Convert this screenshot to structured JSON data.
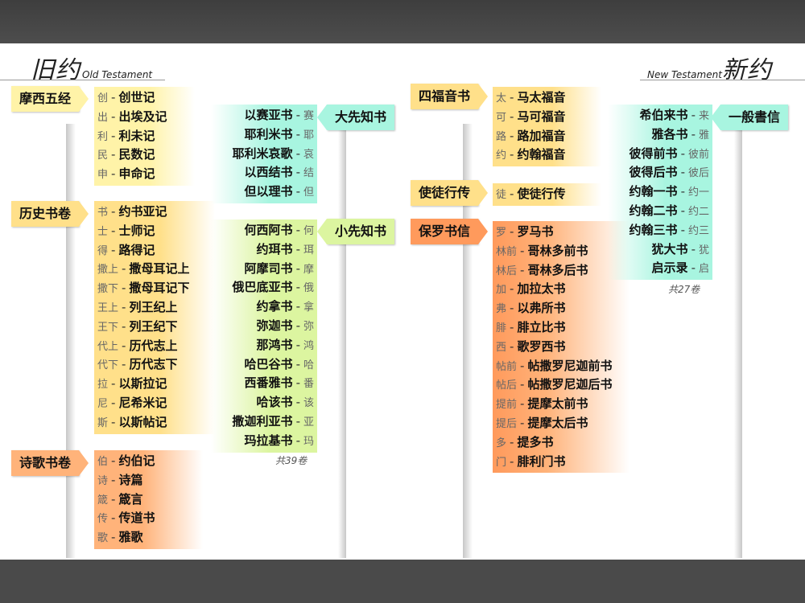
{
  "headings": {
    "ot_cn": "旧约",
    "ot_en": "Old Testament",
    "nt_en": "New Testament",
    "nt_cn": "新约"
  },
  "colors": {
    "pentateuch": "#fff3a8",
    "history": "#ffe08a",
    "poetry": "#ffb37a",
    "major": "#a8f5e0",
    "minor": "#dcf5a0",
    "gospels": "#ffe08a",
    "acts": "#ffe08a",
    "pauline": "#ff9a5c",
    "general": "#a8f5e0"
  },
  "ot": {
    "pentateuch": {
      "title": "摩西五经",
      "books": [
        {
          "ab": "创",
          "name": "创世记"
        },
        {
          "ab": "出",
          "name": "出埃及记"
        },
        {
          "ab": "利",
          "name": "利未记"
        },
        {
          "ab": "民",
          "name": "民数记"
        },
        {
          "ab": "申",
          "name": "申命记"
        }
      ]
    },
    "history": {
      "title": "历史书卷",
      "books": [
        {
          "ab": "书",
          "name": "约书亚记"
        },
        {
          "ab": "士",
          "name": "士师记"
        },
        {
          "ab": "得",
          "name": "路得记"
        },
        {
          "ab": "撒上",
          "name": "撒母耳记上"
        },
        {
          "ab": "撒下",
          "name": "撒母耳记下"
        },
        {
          "ab": "王上",
          "name": "列王纪上"
        },
        {
          "ab": "王下",
          "name": "列王纪下"
        },
        {
          "ab": "代上",
          "name": "历代志上"
        },
        {
          "ab": "代下",
          "name": "历代志下"
        },
        {
          "ab": "拉",
          "name": "以斯拉记"
        },
        {
          "ab": "尼",
          "name": "尼希米记"
        },
        {
          "ab": "斯",
          "name": "以斯帖记"
        }
      ]
    },
    "poetry": {
      "title": "诗歌书卷",
      "books": [
        {
          "ab": "伯",
          "name": "约伯记"
        },
        {
          "ab": "诗",
          "name": "诗篇"
        },
        {
          "ab": "箴",
          "name": "箴言"
        },
        {
          "ab": "传",
          "name": "传道书"
        },
        {
          "ab": "歌",
          "name": "雅歌"
        }
      ]
    },
    "major": {
      "title": "大先知书",
      "books": [
        {
          "ab": "赛",
          "name": "以赛亚书"
        },
        {
          "ab": "耶",
          "name": "耶利米书"
        },
        {
          "ab": "哀",
          "name": "耶利米哀歌"
        },
        {
          "ab": "结",
          "name": "以西结书"
        },
        {
          "ab": "但",
          "name": "但以理书"
        }
      ]
    },
    "minor": {
      "title": "小先知书",
      "books": [
        {
          "ab": "何",
          "name": "何西阿书"
        },
        {
          "ab": "珥",
          "name": "约珥书"
        },
        {
          "ab": "摩",
          "name": "阿摩司书"
        },
        {
          "ab": "俄",
          "name": "俄巴底亚书"
        },
        {
          "ab": "拿",
          "name": "约拿书"
        },
        {
          "ab": "弥",
          "name": "弥迦书"
        },
        {
          "ab": "鸿",
          "name": "那鸿书"
        },
        {
          "ab": "哈",
          "name": "哈巴谷书"
        },
        {
          "ab": "番",
          "name": "西番雅书"
        },
        {
          "ab": "该",
          "name": "哈该书"
        },
        {
          "ab": "亚",
          "name": "撒迦利亚书"
        },
        {
          "ab": "玛",
          "name": "玛拉基书"
        }
      ]
    },
    "count": "共39卷"
  },
  "nt": {
    "gospels": {
      "title": "四福音书",
      "books": [
        {
          "ab": "太",
          "name": "马太福音"
        },
        {
          "ab": "可",
          "name": "马可福音"
        },
        {
          "ab": "路",
          "name": "路加福音"
        },
        {
          "ab": "约",
          "name": "约翰福音"
        }
      ]
    },
    "acts": {
      "title": "使徒行传",
      "books": [
        {
          "ab": "徒",
          "name": "使徒行传"
        }
      ]
    },
    "pauline": {
      "title": "保罗书信",
      "books": [
        {
          "ab": "罗",
          "name": "罗马书"
        },
        {
          "ab": "林前",
          "name": "哥林多前书"
        },
        {
          "ab": "林后",
          "name": "哥林多后书"
        },
        {
          "ab": "加",
          "name": "加拉太书"
        },
        {
          "ab": "弗",
          "name": "以弗所书"
        },
        {
          "ab": "腓",
          "name": "腓立比书"
        },
        {
          "ab": "西",
          "name": "歌罗西书"
        },
        {
          "ab": "帖前",
          "name": "帖撒罗尼迦前书"
        },
        {
          "ab": "帖后",
          "name": "帖撒罗尼迦后书"
        },
        {
          "ab": "提前",
          "name": "提摩太前书"
        },
        {
          "ab": "提后",
          "name": "提摩太后书"
        },
        {
          "ab": "多",
          "name": "提多书"
        },
        {
          "ab": "门",
          "name": "腓利门书"
        }
      ]
    },
    "general": {
      "title": "一般書信",
      "books": [
        {
          "ab": "来",
          "name": "希伯来书"
        },
        {
          "ab": "雅",
          "name": "雅各书"
        },
        {
          "ab": "彼前",
          "name": "彼得前书"
        },
        {
          "ab": "彼后",
          "name": "彼得后书"
        },
        {
          "ab": "约一",
          "name": "约翰一书"
        },
        {
          "ab": "约二",
          "name": "约翰二书"
        },
        {
          "ab": "约三",
          "name": "约翰三书"
        },
        {
          "ab": "犹",
          "name": "犹大书"
        },
        {
          "ab": "启",
          "name": "启示录"
        }
      ]
    },
    "count": "共27卷"
  }
}
